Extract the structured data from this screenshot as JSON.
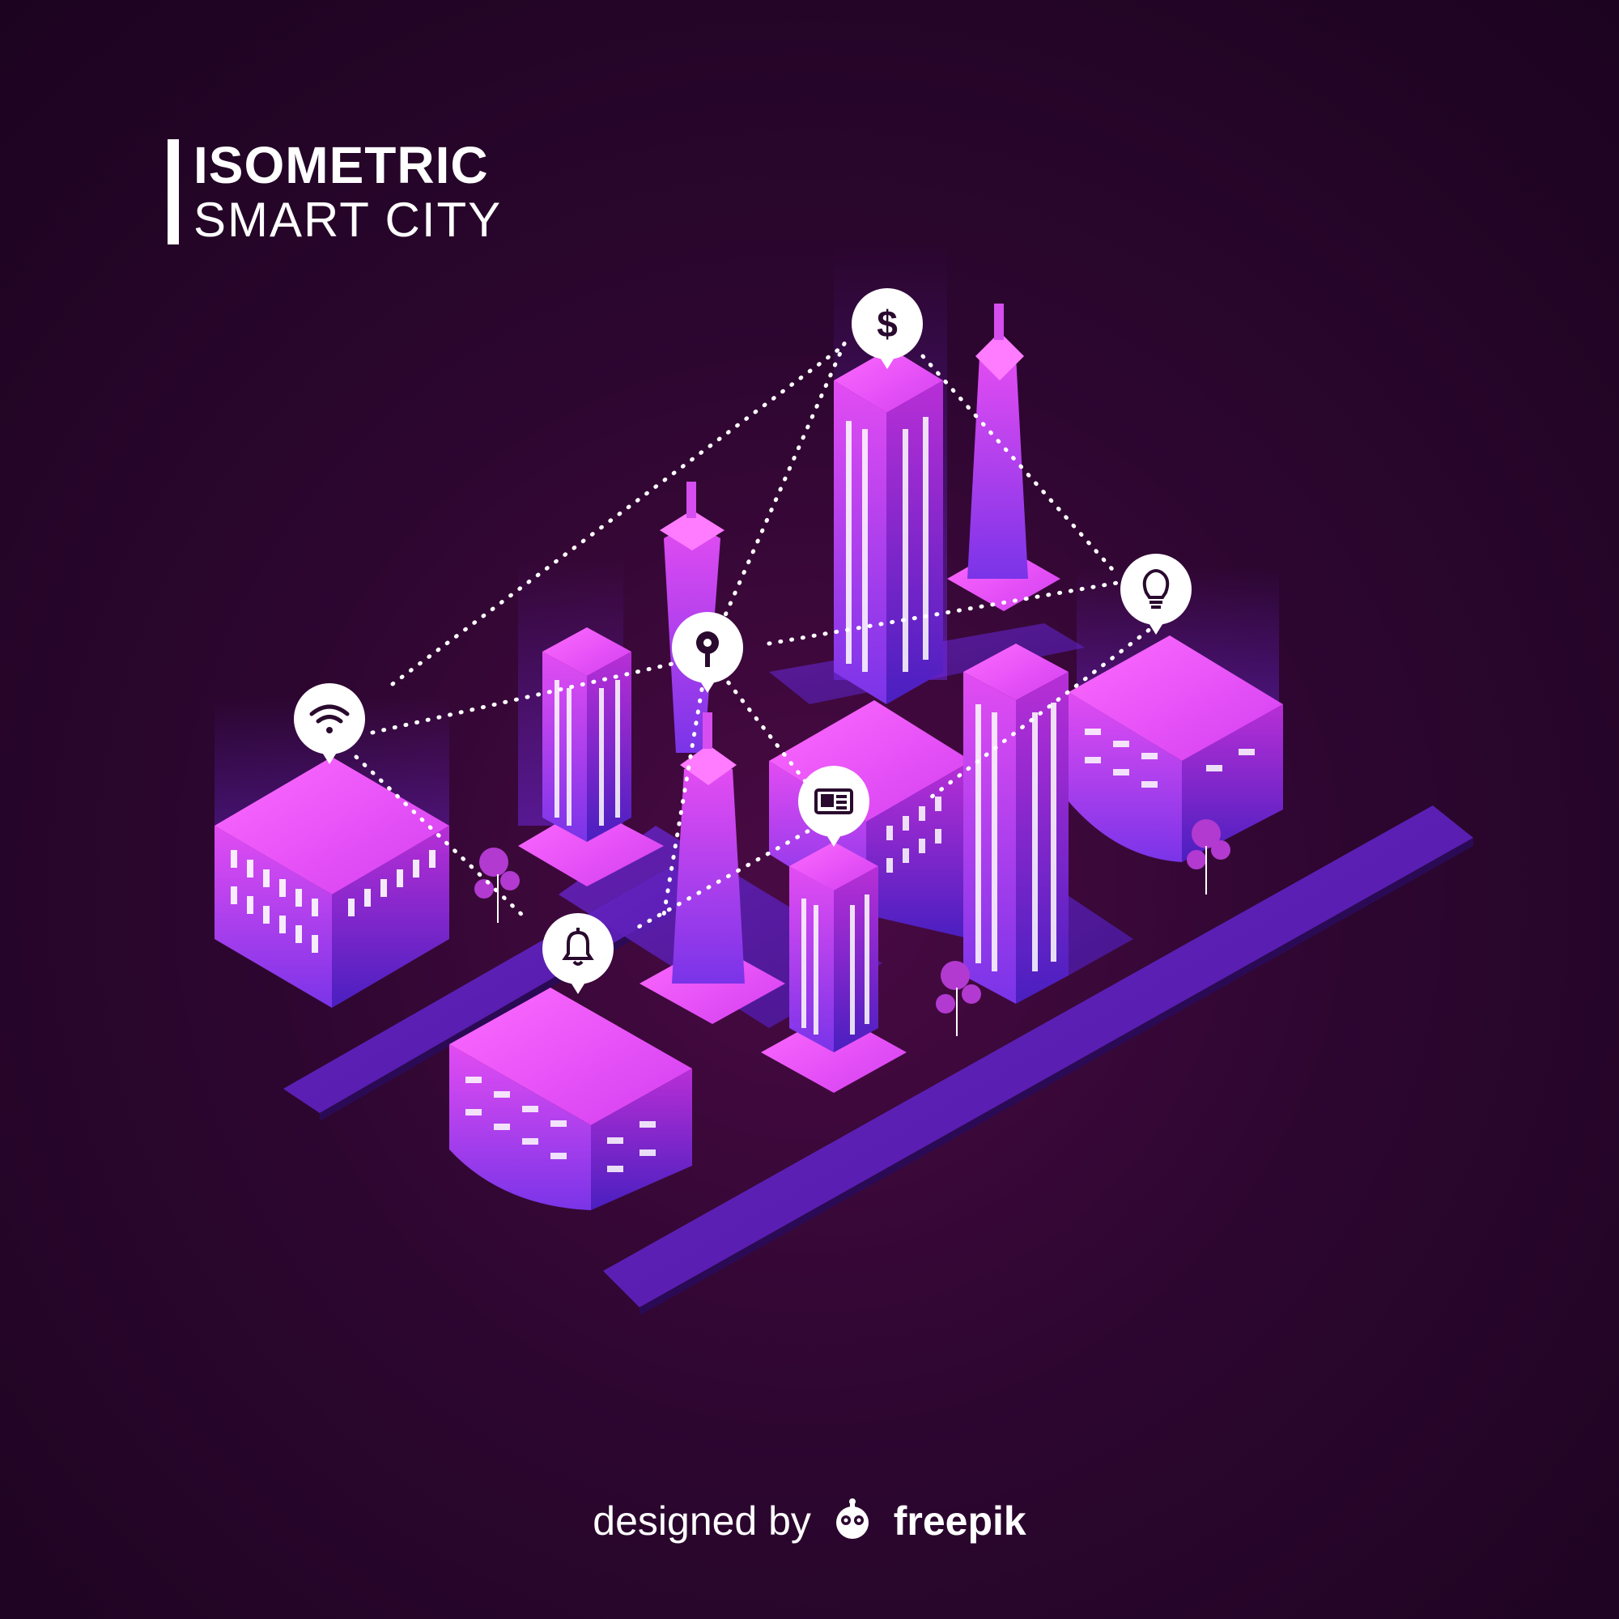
{
  "title": {
    "line1": "ISOMETRIC",
    "line2": "SMART CITY"
  },
  "credit": {
    "prefix": "designed by",
    "brand": "freepik"
  },
  "colors": {
    "background": "#2d0630",
    "building_top": "#ff4dff",
    "building_side_light": "#c23bd8",
    "building_side_dark": "#6a1fd0",
    "road": "#5a1fb5",
    "window": "#ffffff",
    "pin": "#ffffff",
    "pin_icon": "#2a0a2e"
  },
  "pins": [
    {
      "icon": "wifi-icon"
    },
    {
      "icon": "dollar-icon"
    },
    {
      "icon": "location-icon"
    },
    {
      "icon": "lightbulb-icon"
    },
    {
      "icon": "newspaper-icon"
    },
    {
      "icon": "bell-icon"
    }
  ]
}
